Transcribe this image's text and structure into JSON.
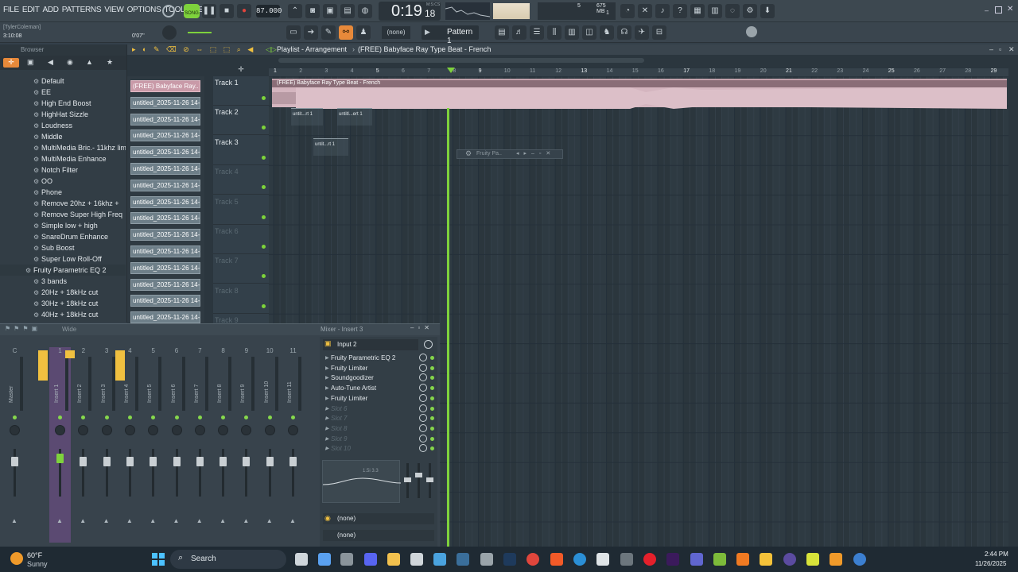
{
  "menu": [
    "FILE",
    "EDIT",
    "ADD",
    "PATTERNS",
    "VIEW",
    "OPTIONS",
    "TOOLS",
    "HELP"
  ],
  "transport": {
    "song_label": "SONG",
    "tempo": "87.000",
    "time": "0:19",
    "time_sub": "18",
    "time_unit": "M:S:CS",
    "cpu": "675 MB",
    "cpu_sub": "1",
    "voices": "5"
  },
  "hint": {
    "user": "[TylerColeman]",
    "elapsed": "3:10:08",
    "offset": "0'07''"
  },
  "toolbar2": {
    "snap": "(none)",
    "pattern": "Pattern 1"
  },
  "browser": {
    "title": "Browser",
    "items": [
      {
        "label": "Default",
        "type": "preset"
      },
      {
        "label": "EE",
        "type": "preset"
      },
      {
        "label": "High End Boost",
        "type": "preset"
      },
      {
        "label": "HighHat Sizzle",
        "type": "preset"
      },
      {
        "label": "Loudness",
        "type": "preset"
      },
      {
        "label": "Middle",
        "type": "preset"
      },
      {
        "label": "MultiMedia Bric.- 11khz limit",
        "type": "preset"
      },
      {
        "label": "MultiMedia Enhance",
        "type": "preset"
      },
      {
        "label": "Notch Filter",
        "type": "preset"
      },
      {
        "label": "OO",
        "type": "preset"
      },
      {
        "label": "Phone",
        "type": "preset"
      },
      {
        "label": "Remove 20hz + 16khz +",
        "type": "preset"
      },
      {
        "label": "Remove Super High Freq",
        "type": "preset"
      },
      {
        "label": "Simple low + high",
        "type": "preset"
      },
      {
        "label": "SnareDrum Enhance",
        "type": "preset"
      },
      {
        "label": "Sub Boost",
        "type": "preset"
      },
      {
        "label": "Super Low Roll-Off",
        "type": "preset"
      },
      {
        "label": "Fruity Parametric EQ 2",
        "type": "folder"
      },
      {
        "label": "3 bands",
        "type": "preset"
      },
      {
        "label": "20Hz + 18kHz cut",
        "type": "preset"
      },
      {
        "label": "30Hz + 18kHz cut",
        "type": "preset"
      },
      {
        "label": "40Hz + 18kHz cut",
        "type": "preset"
      }
    ]
  },
  "clips": [
    "(FREE) Babyface Ray..",
    "untitled_2025-11-26 14-..",
    "untitled_2025-11-26 14-..",
    "untitled_2025-11-26 14-..",
    "untitled_2025-11-26 14-..",
    "untitled_2025-11-26 14-..",
    "untitled_2025-11-26 14-..",
    "untitled_2025-11-26 14-..",
    "untitled_2025-11-26 14-..",
    "untitled_2025-11-26 14-..",
    "untitled_2025-11-26 14-..",
    "untitled_2025-11-26 14-..",
    "untitled_2025-11-26 14-..",
    "untitled_2025-11-26 14-..",
    "untitled_2025-11-26 14-.."
  ],
  "playlist": {
    "title": "Playlist - Arrangement",
    "sep": "›",
    "pattern": "(FREE) Babyface Ray Type Beat - French",
    "ruler": [
      "1",
      "2",
      "3",
      "4",
      "5",
      "6",
      "7",
      "8",
      "9",
      "10",
      "11",
      "12",
      "13",
      "14",
      "15",
      "16",
      "17",
      "18",
      "19",
      "20",
      "21",
      "22",
      "23",
      "24",
      "25",
      "26",
      "27",
      "28",
      "29"
    ],
    "tracks": [
      {
        "name": "Track 1"
      },
      {
        "name": "Track 2"
      },
      {
        "name": "Track 3"
      },
      {
        "name": "Track 4"
      },
      {
        "name": "Track 5"
      },
      {
        "name": "Track 6"
      },
      {
        "name": "Track 7"
      },
      {
        "name": "Track 8"
      },
      {
        "name": "Track 9"
      }
    ],
    "audio_clip": "(FREE) Babyface Ray Type Beat - French",
    "small_clips": [
      "untit...rt 1",
      "untitl...ert 1",
      "untit...rt 1"
    ],
    "floating": "Fruity Pa.."
  },
  "mixer": {
    "label": "Wide",
    "title": "Mixer - Insert 3",
    "input": "Input 2",
    "channels": [
      {
        "num": "C",
        "name": "Master"
      },
      {
        "num": "M",
        "name": ""
      },
      {
        "num": "1",
        "name": "Insert 1"
      },
      {
        "num": "2",
        "name": "Insert 2"
      },
      {
        "num": "3",
        "name": "Insert 3"
      },
      {
        "num": "4",
        "name": "Insert 4"
      },
      {
        "num": "5",
        "name": "Insert 5"
      },
      {
        "num": "6",
        "name": "Insert 6"
      },
      {
        "num": "7",
        "name": "Insert 7"
      },
      {
        "num": "8",
        "name": "Insert 8"
      },
      {
        "num": "9",
        "name": "Insert 9"
      },
      {
        "num": "10",
        "name": "Insert 10"
      },
      {
        "num": "11",
        "name": "Insert 11"
      }
    ],
    "slots": [
      {
        "label": "Fruity Parametric EQ 2",
        "active": true
      },
      {
        "label": "Fruity Limiter",
        "active": true
      },
      {
        "label": "Soundgoodizer",
        "active": true
      },
      {
        "label": "Auto-Tune Artist",
        "active": true
      },
      {
        "label": "Fruity Limiter",
        "active": true
      },
      {
        "label": "Slot 6",
        "active": false
      },
      {
        "label": "Slot 7",
        "active": false
      },
      {
        "label": "Slot 8",
        "active": false
      },
      {
        "label": "Slot 9",
        "active": false
      },
      {
        "label": "Slot 10",
        "active": false
      }
    ],
    "eq_readout": "1.5i 3.3",
    "send1": "(none)",
    "send2": "(none)"
  },
  "taskbar": {
    "temp": "60°F",
    "weather": "Sunny",
    "search": "Search",
    "time": "2:44 PM",
    "date": "11/26/2025"
  },
  "colors": {
    "accent": "#7ed23c",
    "audio_clip": "#d6b3bd",
    "playhead": "#7ed23c"
  }
}
